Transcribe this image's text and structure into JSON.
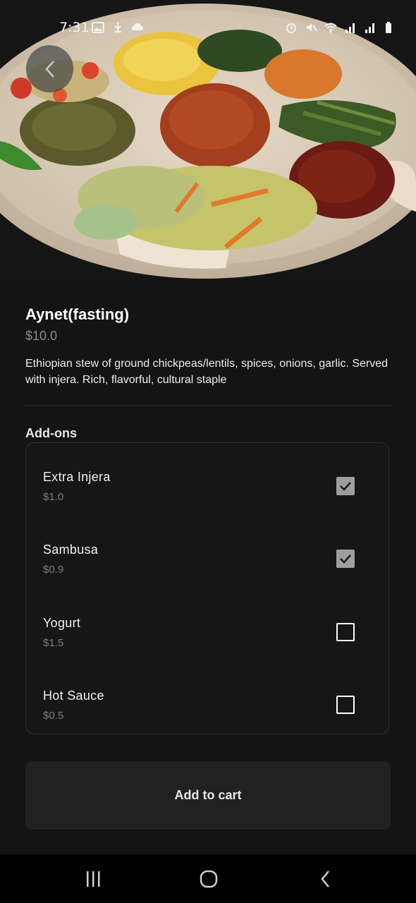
{
  "status_bar": {
    "time": "7:31",
    "left_icons": [
      "gallery-icon",
      "usb-debug-icon",
      "weather-icon"
    ],
    "right_icons": [
      "alarm-icon",
      "mute-icon",
      "wifi-icon",
      "signal-icon",
      "signal-icon",
      "battery-icon"
    ]
  },
  "hero": {
    "image": "injera-platter-photo",
    "back_icon": "chevron-left-icon"
  },
  "item": {
    "title": "Aynet(fasting)",
    "price": "$10.0",
    "description": "Ethiopian stew of ground chickpeas/lentils, spices, onions, garlic. Served with injera. Rich, flavorful, cultural staple"
  },
  "addons": {
    "heading": "Add-ons",
    "items": [
      {
        "name": "Extra Injera",
        "price": "$1.0",
        "checked": true
      },
      {
        "name": "Sambusa",
        "price": "$0.9",
        "checked": true
      },
      {
        "name": "Yogurt",
        "price": "$1.5",
        "checked": false
      },
      {
        "name": "Hot Sauce",
        "price": "$0.5",
        "checked": false
      }
    ]
  },
  "cart_button": {
    "label": "Add to cart"
  },
  "nav": {
    "icons": [
      "recent-apps-icon",
      "home-icon",
      "back-icon"
    ]
  },
  "colors": {
    "background": "#141414",
    "panel_border": "#2d2d2d",
    "button_bg": "#212121",
    "checkbox_checked": "#9e9e9e"
  }
}
